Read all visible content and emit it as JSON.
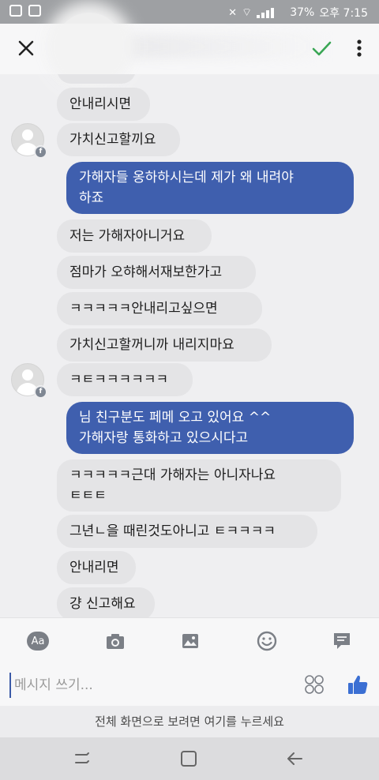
{
  "status_bar": {
    "battery": "37%",
    "time": "오후 7:15",
    "icons": [
      "messenger-icon",
      "gallery-icon",
      "mute-icon",
      "wifi-icon",
      "signal-icon",
      "battery-icon"
    ]
  },
  "header": {
    "close_icon": "close-icon",
    "confirm_icon": "check-icon",
    "more_icon": "more-vertical-icon"
  },
  "messages": [
    {
      "side": "in",
      "text": "안내리시면"
    },
    {
      "side": "in",
      "text": "가치신고할끼요"
    },
    {
      "side": "out",
      "text": "가해자들 옹하하시는데 제가 왜 내려야\n하죠"
    },
    {
      "side": "in",
      "text": "저는 가해자아니거요"
    },
    {
      "side": "in",
      "text": "점마가 오햐해서재보한가고"
    },
    {
      "side": "in",
      "text": "ㅋㅋㅋㅋㅋ안내리고싶으면"
    },
    {
      "side": "in",
      "text": "가치신고할꺼니까 내리지마요"
    },
    {
      "side": "in",
      "text": "ㅋㅌㅋㅋㅋㅋㅋㅋ"
    },
    {
      "side": "out",
      "text": "님 친구분도 페메 오고 있어요 ^^\n가해자랑 통화하고 있으시다고"
    },
    {
      "side": "in",
      "text": "ㅋㅋㅋㅋㅋ근대 가해자는 아니자나요\nㅌㅌㅌ"
    },
    {
      "side": "in",
      "text": "그년ㄴ을 때린것도아니고 ㅌㅋㅋㅋㅋ"
    },
    {
      "side": "in",
      "text": "안내리면"
    },
    {
      "side": "in",
      "text": "걍 신고해요"
    }
  ],
  "toolbar": {
    "aa_label": "Aa",
    "icons": [
      "text-format-icon",
      "camera-icon",
      "image-icon",
      "emoji-icon",
      "quick-reply-icon"
    ]
  },
  "composer": {
    "placeholder": "메시지 쓰기...",
    "sticker_icon": "sticker-icon",
    "like_icon": "thumbs-up-icon"
  },
  "fullscreen_hint": "전체 화면으로 보려면 여기를 누르세요",
  "nav": {
    "icons": [
      "recent-apps-icon",
      "home-icon",
      "back-icon"
    ]
  },
  "colors": {
    "outgoing": "#3f5fae",
    "incoming": "#e4e4e6",
    "accent_check": "#3aa655",
    "like": "#3b6fd3"
  }
}
